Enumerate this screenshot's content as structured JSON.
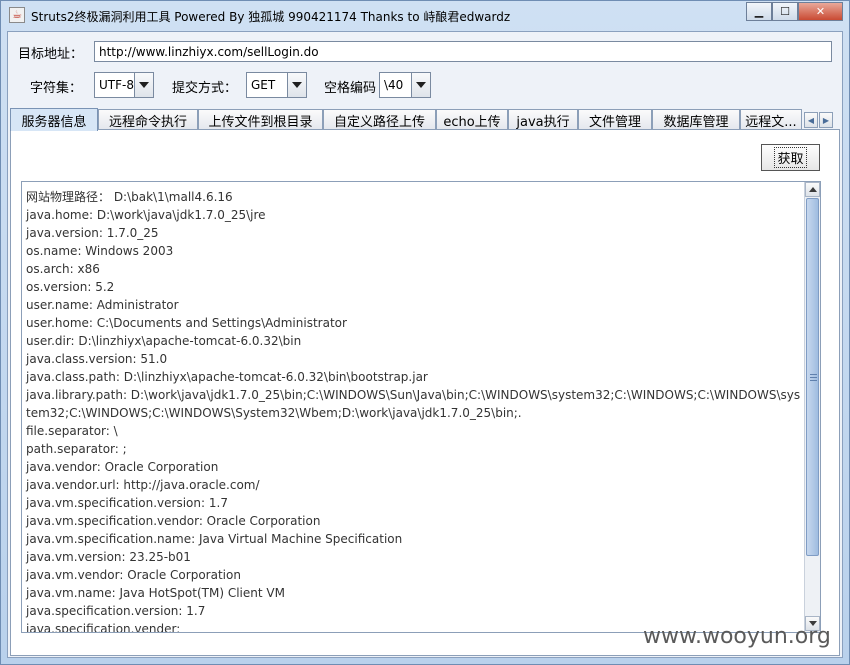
{
  "window": {
    "title": "Struts2终极漏洞利用工具   Powered By 独孤城 990421174 Thanks to 峙酿君edwardz",
    "icon": "java-cup-icon",
    "minimize_label": "▁",
    "maximize_label": "☐",
    "close_label": "✕"
  },
  "form": {
    "target_label": "目标地址：",
    "target_value": "http://www.linzhiyx.com/sellLogin.do",
    "charset_label": "字符集：",
    "charset_value": "UTF-8",
    "method_label": "提交方式：",
    "method_value": "GET",
    "space_label": "空格编码",
    "space_value": "\\40"
  },
  "tabs": [
    {
      "label": "服务器信息",
      "active": true
    },
    {
      "label": "远程命令执行",
      "active": false
    },
    {
      "label": "上传文件到根目录",
      "active": false
    },
    {
      "label": "自定义路径上传",
      "active": false
    },
    {
      "label": "echo上传",
      "active": false
    },
    {
      "label": "java执行",
      "active": false
    },
    {
      "label": "文件管理",
      "active": false
    },
    {
      "label": "数据库管理",
      "active": false
    },
    {
      "label": "远程文...",
      "active": false
    }
  ],
  "tab_scroll": {
    "left": "◀",
    "right": "▶"
  },
  "panel": {
    "fetch_button": "获取",
    "output": "网站物理路径： D:\\bak\\1\\mall4.6.16\njava.home: D:\\work\\java\\jdk1.7.0_25\\jre\njava.version: 1.7.0_25\nos.name: Windows 2003\nos.arch: x86\nos.version: 5.2\nuser.name: Administrator\nuser.home: C:\\Documents and Settings\\Administrator\nuser.dir: D:\\linzhiyx\\apache-tomcat-6.0.32\\bin\njava.class.version: 51.0\njava.class.path: D:\\linzhiyx\\apache-tomcat-6.0.32\\bin\\bootstrap.jar\njava.library.path: D:\\work\\java\\jdk1.7.0_25\\bin;C:\\WINDOWS\\Sun\\Java\\bin;C:\\WINDOWS\\system32;C:\\WINDOWS;C:\\WINDOWS\\system32;C:\\WINDOWS;C:\\WINDOWS\\System32\\Wbem;D:\\work\\java\\jdk1.7.0_25\\bin;.\nfile.separator: \\\npath.separator: ;\njava.vendor: Oracle Corporation\njava.vendor.url: http://java.oracle.com/\njava.vm.specification.version: 1.7\njava.vm.specification.vendor: Oracle Corporation\njava.vm.specification.name: Java Virtual Machine Specification\njava.vm.version: 23.25-b01\njava.vm.vendor: Oracle Corporation\njava.vm.name: Java HotSpot(TM) Client VM\njava.specification.version: 1.7\njava.specification.vender:"
  },
  "watermark": "www.wooyun.org"
}
